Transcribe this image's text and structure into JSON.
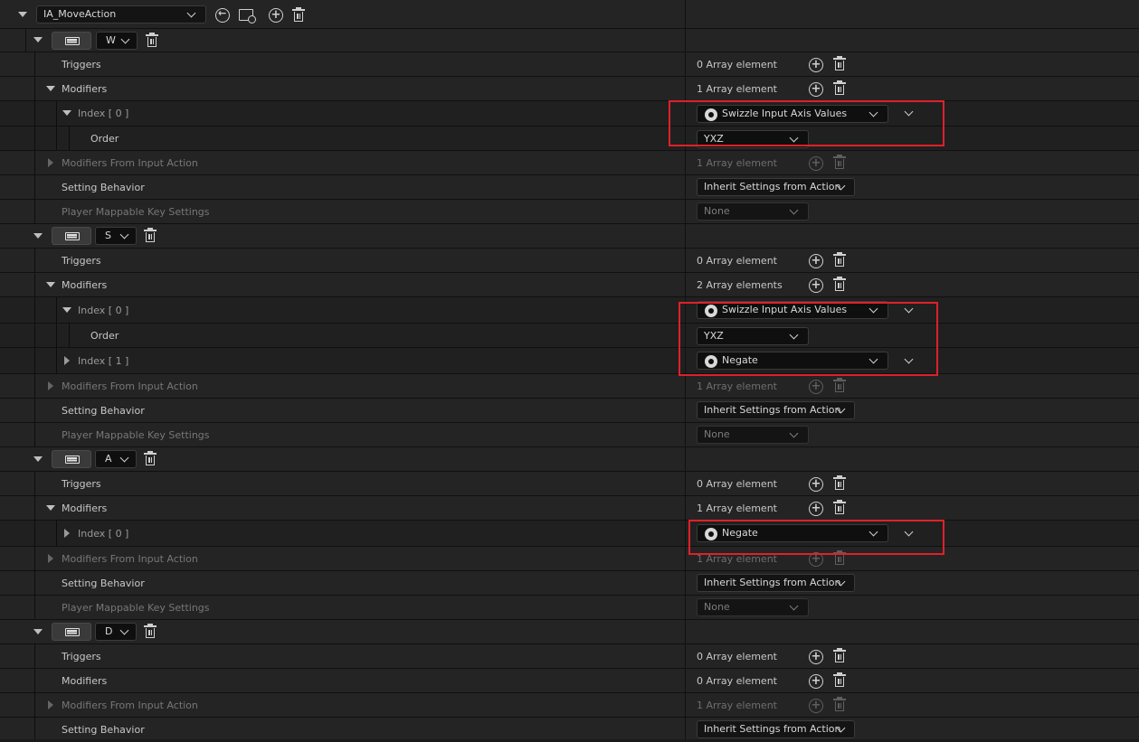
{
  "action_selector": {
    "value": "IA_MoveAction"
  },
  "labels": {
    "triggers": "Triggers",
    "modifiers": "Modifiers",
    "modifiers_from_input_action": "Modifiers From Input Action",
    "setting_behavior": "Setting Behavior",
    "player_mappable": "Player Mappable Key Settings",
    "order": "Order",
    "index0": "Index [ 0 ]",
    "index1": "Index [ 1 ]"
  },
  "values": {
    "zero_elements": "0 Array element",
    "one_element": "1 Array element",
    "two_elements": "2 Array elements",
    "swizzle": "Swizzle Input Axis Values",
    "negate": "Negate",
    "order_yxz": "YXZ",
    "inherit": "Inherit Settings from Action",
    "none": "None"
  },
  "mappings": [
    {
      "key": "W"
    },
    {
      "key": "S"
    },
    {
      "key": "A"
    },
    {
      "key": "D"
    }
  ],
  "colors": {
    "highlight": "#e0202a",
    "background": "#242424"
  }
}
